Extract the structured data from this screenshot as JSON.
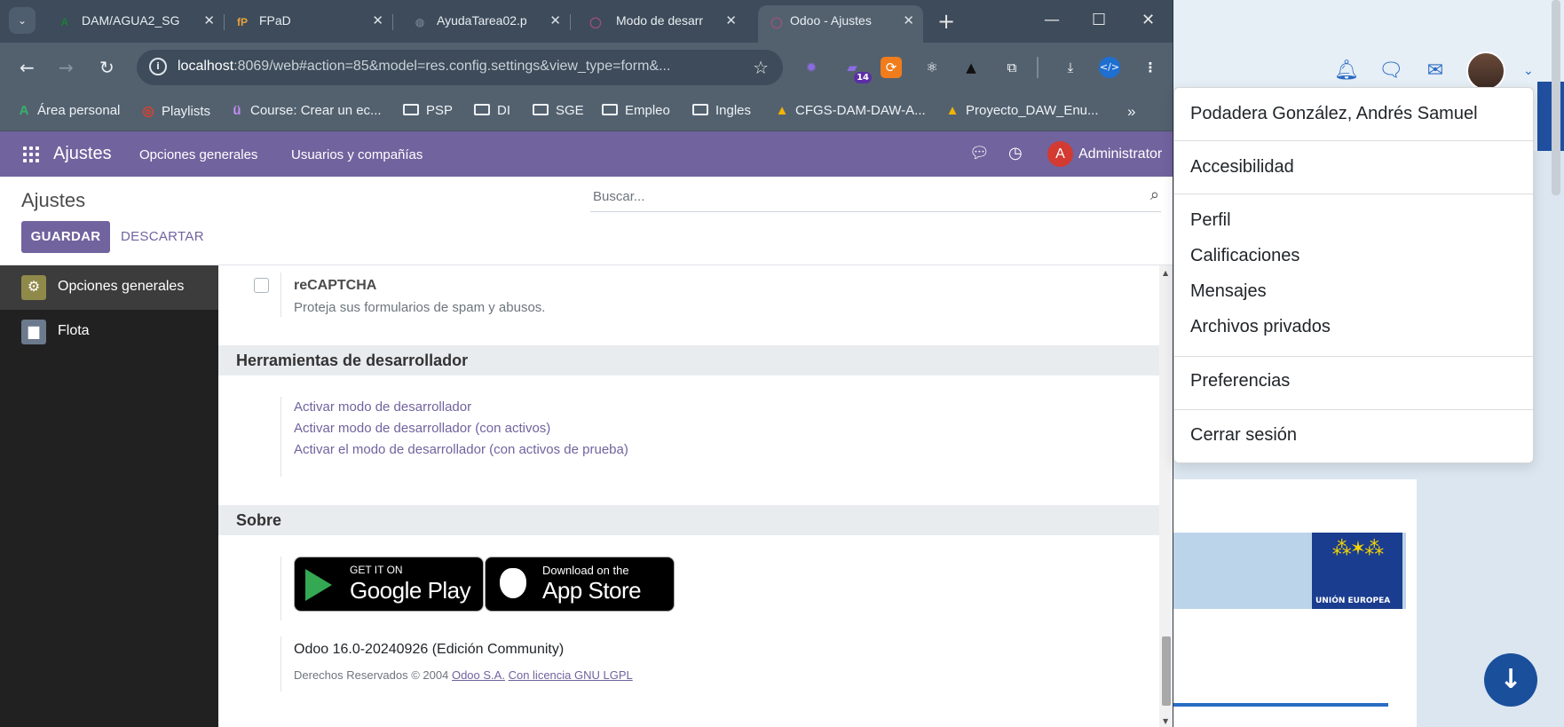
{
  "browser": {
    "tabs": [
      {
        "title": "DAM/AGUA2_SG",
        "favicon": "A",
        "favicon_color": "#1b7d3a"
      },
      {
        "title": "FPaD",
        "favicon": "fP",
        "favicon_color": "#e8a23a"
      },
      {
        "title": "AyudaTarea02.p",
        "favicon": "◍",
        "favicon_color": "#6b7785"
      },
      {
        "title": "Modo de desarr",
        "favicon": "◯",
        "favicon_color": "#a0517a"
      },
      {
        "title": "Odoo - Ajustes",
        "favicon": "◯",
        "favicon_color": "#a0517a"
      }
    ],
    "url_host": "localhost",
    "url_rest": ":8069/web#action=85&model=res.config.settings&view_type=form&...",
    "extensions": [
      {
        "name": "gear-extension-icon",
        "glyph": "✹",
        "color": "#8a6ae0"
      },
      {
        "name": "graduation-extension-icon",
        "glyph": "🎓",
        "color": "#5b2ea6",
        "badge": "14"
      },
      {
        "name": "sync-extension-icon",
        "glyph": "⟳",
        "color": "#f07c1c"
      },
      {
        "name": "react-extension-icon",
        "glyph": "⚛",
        "color": "transparent"
      },
      {
        "name": "angular-extension-icon",
        "glyph": "▲",
        "color": "#222"
      },
      {
        "name": "puzzle-extension-icon",
        "glyph": "⧉",
        "color": "transparent"
      }
    ],
    "bookmarks": [
      {
        "label": "Área personal",
        "type": "icon",
        "glyph": "A",
        "color": "#1b7d3a"
      },
      {
        "label": "Playlists",
        "type": "icon",
        "glyph": "◎",
        "color": "#e0402b"
      },
      {
        "label": "Course: Crear un ec...",
        "type": "icon",
        "glyph": "ü",
        "color": "#9b59d6"
      },
      {
        "label": "PSP",
        "type": "folder"
      },
      {
        "label": "DI",
        "type": "folder"
      },
      {
        "label": "SGE",
        "type": "folder"
      },
      {
        "label": "Empleo",
        "type": "folder"
      },
      {
        "label": "Ingles",
        "type": "folder"
      },
      {
        "label": "CFGS-DAM-DAW-A...",
        "type": "icon",
        "glyph": "▲",
        "color": "#f2b400"
      },
      {
        "label": "Proyecto_DAW_Enu...",
        "type": "icon",
        "glyph": "▲",
        "color": "#f2b400"
      }
    ]
  },
  "odoo": {
    "app_name": "Ajustes",
    "menu": [
      "Opciones generales",
      "Usuarios y compañías"
    ],
    "user_initial": "A",
    "user_name": "Administrator",
    "breadcrumb": "Ajustes",
    "search_placeholder": "Buscar...",
    "save_label": "GUARDAR",
    "discard_label": "DESCARTAR",
    "sidebar": [
      {
        "label": "Opciones generales",
        "icon": "⚙",
        "icon_bg": "#8f8a4a"
      },
      {
        "label": "Flota",
        "icon": "🚘",
        "icon_bg": "#6b7a8c"
      }
    ],
    "recaptcha": {
      "title": "reCAPTCHA",
      "description": "Proteja sus formularios de spam y abusos."
    },
    "dev_tools": {
      "heading": "Herramientas de desarrollador",
      "links": [
        "Activar modo de desarrollador",
        "Activar modo de desarrollador (con activos)",
        "Activar el modo de desarrollador (con activos de prueba)"
      ]
    },
    "about": {
      "heading": "Sobre",
      "google_small": "GET IT ON",
      "google_big": "Google Play",
      "apple_small": "Download on the",
      "apple_big": "App Store",
      "version": "Odoo 16.0-20240926 (Edición Community)",
      "rights_prefix": "Derechos Reservados © 2004",
      "rights_link1": "Odoo S.A.",
      "rights_link2": "Con licencia GNU LGPL"
    }
  },
  "user_menu": {
    "full_name": "Podadera González, Andrés Samuel",
    "items": [
      "Accesibilidad",
      "Perfil",
      "Calificaciones",
      "Mensajes",
      "Archivos privados",
      "Preferencias",
      "Cerrar sesión"
    ]
  },
  "background_site": {
    "eu_label": "UNIÓN EUROPEA"
  }
}
